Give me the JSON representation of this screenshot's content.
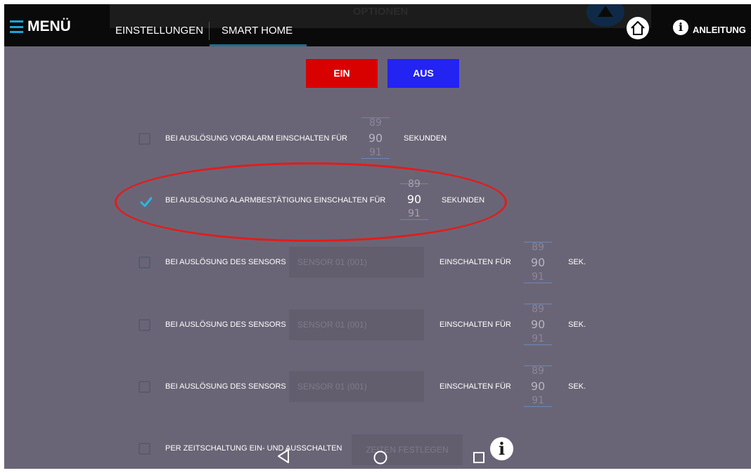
{
  "header": {
    "menu_label": "MENÜ",
    "options_ghost": "OPTIONEN",
    "tabs": [
      {
        "label": "EINSTELLUNGEN"
      },
      {
        "label": "SMART HOME"
      }
    ],
    "anleitung_label": "ANLEITUNG"
  },
  "toggles": {
    "on_label": "EIN",
    "off_label": "AUS",
    "on_color": "#d90000",
    "off_color": "#2323f2"
  },
  "rows": [
    {
      "label": "BEI AUSLÖSUNG VORALARM EINSCHALTEN FÜR",
      "picker": {
        "prev": "89",
        "value": "90",
        "next": "91"
      },
      "unit": "SEKUNDEN",
      "checked": false
    },
    {
      "label": "BEI AUSLÖSUNG ALARMBESTÄTIGUNG EINSCHALTEN FÜR",
      "picker": {
        "prev": "89",
        "value": "90",
        "next": "91"
      },
      "unit": "SEKUNDEN",
      "checked": true
    },
    {
      "label": "BEI AUSLÖSUNG DES SENSORS",
      "sensor": "SENSOR 01 (001)",
      "switch_label": "EINSCHALTEN FÜR",
      "picker": {
        "prev": "89",
        "value": "90",
        "next": "91"
      },
      "unit": "SEK.",
      "checked": false
    },
    {
      "label": "BEI AUSLÖSUNG DES SENSORS",
      "sensor": "SENSOR 01 (001)",
      "switch_label": "EINSCHALTEN FÜR",
      "picker": {
        "prev": "89",
        "value": "90",
        "next": "91"
      },
      "unit": "SEK.",
      "checked": false
    },
    {
      "label": "BEI AUSLÖSUNG DES SENSORS",
      "sensor": "SENSOR 01 (001)",
      "switch_label": "EINSCHALTEN FÜR",
      "picker": {
        "prev": "89",
        "value": "90",
        "next": "91"
      },
      "unit": "SEK.",
      "checked": false
    },
    {
      "label": "PER ZEITSCHALTUNG EIN- UND AUSSCHALTEN",
      "button": "ZEITEN FESTLEGEN",
      "checked": false
    }
  ],
  "colors": {
    "background": "#6a6576",
    "accent": "#1aa4d9",
    "highlight": "#e21c1c"
  },
  "icons": [
    "hamburger-icon",
    "home-icon",
    "info-icon",
    "back-icon",
    "home-circle-icon",
    "recents-icon"
  ]
}
